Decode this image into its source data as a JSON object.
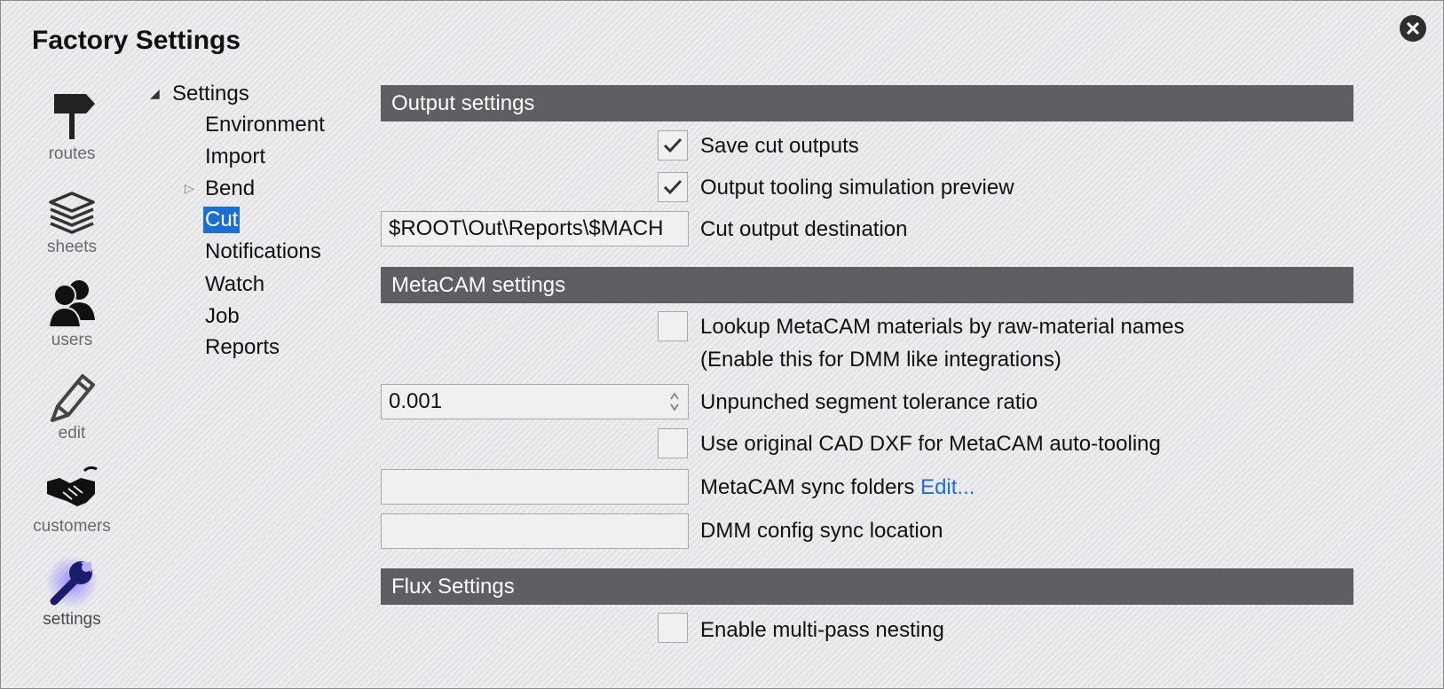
{
  "window": {
    "title": "Factory Settings"
  },
  "nav": [
    {
      "id": "routes",
      "label": "routes",
      "icon": "signpost-icon"
    },
    {
      "id": "sheets",
      "label": "sheets",
      "icon": "sheets-stack-icon"
    },
    {
      "id": "users",
      "label": "users",
      "icon": "users-icon"
    },
    {
      "id": "edit",
      "label": "edit",
      "icon": "pencil-icon"
    },
    {
      "id": "customers",
      "label": "customers",
      "icon": "handshake-icon"
    },
    {
      "id": "settings",
      "label": "settings",
      "icon": "wrench-icon",
      "active": true
    }
  ],
  "tree": {
    "root": "Settings",
    "children": [
      "Environment",
      "Import",
      "Bend",
      "Cut",
      "Notifications",
      "Watch",
      "Job",
      "Reports"
    ],
    "selected": "Cut"
  },
  "output_settings": {
    "header": "Output settings",
    "save_cut_outputs": {
      "label": "Save cut outputs",
      "checked": true
    },
    "tooling_preview": {
      "label": "Output tooling simulation preview",
      "checked": true
    },
    "cut_output_destination": {
      "label": "Cut output destination",
      "value": "$ROOT\\Out\\Reports\\$MACH"
    }
  },
  "metacam_settings": {
    "header": "MetaCAM settings",
    "lookup_materials": {
      "label_line1": "Lookup MetaCAM materials by raw-material names",
      "label_line2": "(Enable this for DMM like integrations)",
      "checked": false
    },
    "tolerance": {
      "label": "Unpunched segment tolerance ratio",
      "value": "0.001"
    },
    "original_dxf": {
      "label": "Use original CAD DXF for MetaCAM auto-tooling",
      "checked": false
    },
    "sync_folders": {
      "label": "MetaCAM sync folders",
      "link": "Edit...",
      "value": ""
    },
    "dmm_config": {
      "label": "DMM config sync location",
      "value": ""
    }
  },
  "flux_settings": {
    "header": "Flux Settings",
    "multi_pass": {
      "label": "Enable multi-pass nesting",
      "checked": false
    }
  },
  "colors": {
    "header_bg": "#5e5e63",
    "selection": "#1a6fd1",
    "link": "#1a6fd1"
  }
}
